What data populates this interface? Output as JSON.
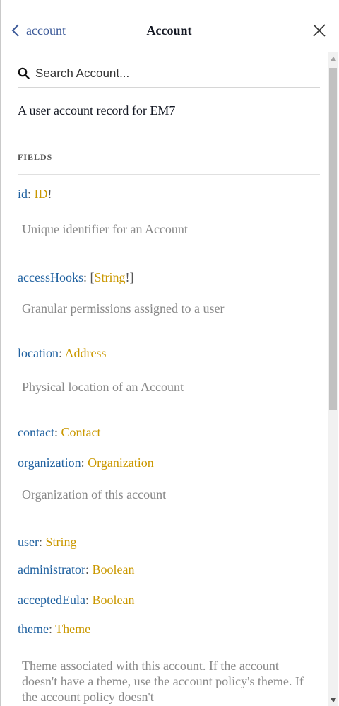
{
  "header": {
    "back_label": "account",
    "title": "Account"
  },
  "search": {
    "placeholder": "Search Account..."
  },
  "type_description": "A user account record for EM7",
  "section_title": "FIELDS",
  "fields": [
    {
      "name": "id",
      "type": "ID",
      "suffix": "!",
      "prefix": "",
      "description": "Unique identifier for an Account"
    },
    {
      "name": "accessHooks",
      "type": "String",
      "prefix": "[",
      "suffix": "!]",
      "description": "Granular permissions assigned to a user"
    },
    {
      "name": "location",
      "type": "Address",
      "prefix": "",
      "suffix": "",
      "description": "Physical location of an Account"
    },
    {
      "name": "contact",
      "type": "Contact",
      "prefix": "",
      "suffix": "",
      "description": ""
    },
    {
      "name": "organization",
      "type": "Organization",
      "prefix": "",
      "suffix": "",
      "description": "Organization of this account"
    },
    {
      "name": "user",
      "type": "String",
      "prefix": "",
      "suffix": "",
      "description": ""
    },
    {
      "name": "administrator",
      "type": "Boolean",
      "prefix": "",
      "suffix": "",
      "description": ""
    },
    {
      "name": "acceptedEula",
      "type": "Boolean",
      "prefix": "",
      "suffix": "",
      "description": ""
    },
    {
      "name": "theme",
      "type": "Theme",
      "prefix": "",
      "suffix": "",
      "description": "Theme associated with this account. If the account doesn't have a theme, use the account policy's theme. If the account policy doesn't"
    }
  ],
  "colors": {
    "field_name": "#1f61a0",
    "field_type": "#ca9800",
    "description": "#888888"
  },
  "icons": {
    "back": "chevron-left-icon",
    "close": "close-icon",
    "search": "search-icon"
  }
}
